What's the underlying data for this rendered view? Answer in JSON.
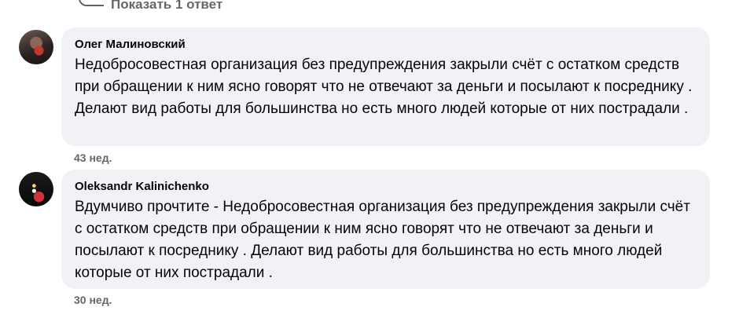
{
  "reply_link": {
    "label": "Показать 1 ответ"
  },
  "comments": [
    {
      "author": "Олег Малиновский",
      "text": "Недобросовестная организация без предупреждения закрыли счёт с остатком средств при обращении к ним ясно говорят что не отвечают за деньги и посылают к посреднику . Делают вид работы для большинства но есть много людей которые от них пострадали .",
      "time": "43 нед."
    },
    {
      "author": "Oleksandr Kalinichenko",
      "text": "Вдумчиво прочтите - Недобросовестная организация без предупреждения закрыли счёт с остатком средств при обращении к ним ясно говорят что не отвечают за деньги и посылают к посреднику . Делают вид работы для большинства но есть много людей которые от них пострадали .",
      "time": "30 нед."
    }
  ]
}
